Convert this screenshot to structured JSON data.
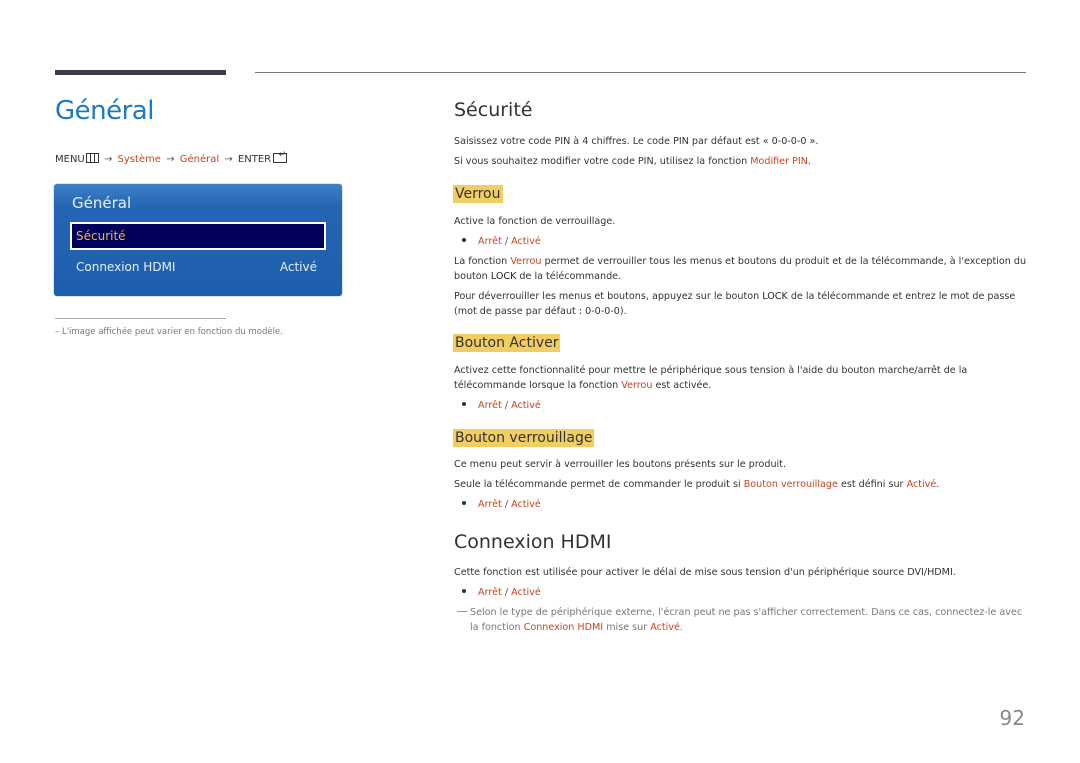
{
  "header": {
    "page_title": "Général",
    "menu_path": {
      "menu": "MENU",
      "menu_icon": "menu-grid-icon",
      "arrow": "→",
      "step1": "Système",
      "step2": "Général",
      "enter": "ENTER",
      "enter_icon": "enter-icon"
    }
  },
  "osd_menu": {
    "title": "Général",
    "items": [
      {
        "label": "Sécurité",
        "value": "",
        "selected": true
      },
      {
        "label": "Connexion HDMI",
        "value": "Activé",
        "selected": false
      }
    ]
  },
  "left_note": "–  L'image affichée peut varier en fonction du modèle.",
  "sections": {
    "securite": {
      "title": "Sécurité",
      "p1": "Saisissez votre code PIN à 4 chiffres. Le code PIN par défaut est « 0-0-0-0 ».",
      "p2_pre": "Si vous souhaitez modifier votre code PIN, utilisez la fonction ",
      "p2_link": "Modifier PIN",
      "p2_post": "."
    },
    "verrou": {
      "title": "Verrou",
      "p1": "Active la fonction de verrouillage.",
      "options": {
        "off": "Arrêt",
        "sep": "/",
        "on": "Activé"
      },
      "p2_pre": "La fonction ",
      "p2_link": "Verrou",
      "p2_mid": " permet de verrouiller tous les menus et boutons du produit et de la télécommande, à l'exception du bouton ",
      "p2_bold": "LOCK",
      "p2_post": " de la télécommande.",
      "p3_pre": "Pour déverrouiller les menus et boutons, appuyez sur le bouton ",
      "p3_bold": "LOCK",
      "p3_post": " de la télécommande et entrez le mot de passe (mot de passe par défaut : 0-0-0-0)."
    },
    "bouton_activer": {
      "title": "Bouton Activer",
      "p1_pre": "Activez cette fonctionnalité pour mettre le périphérique sous tension à l'aide du bouton marche/arrêt de la télécommande lorsque la fonction ",
      "p1_link": "Verrou",
      "p1_post": " est activée.",
      "options": {
        "off": "Arrêt",
        "sep": "/",
        "on": "Activé"
      }
    },
    "bouton_verrouillage": {
      "title": "Bouton verrouillage",
      "p1": "Ce menu peut servir à verrouiller les boutons présents sur le produit.",
      "p2_pre": "Seule la télécommande permet de commander le produit si ",
      "p2_link": "Bouton verrouillage",
      "p2_mid": " est défini sur ",
      "p2_link2": "Activé",
      "p2_post": ".",
      "options": {
        "off": "Arrêt",
        "sep": "/",
        "on": "Activé"
      }
    },
    "connexion_hdmi": {
      "title": "Connexion HDMI",
      "p1": "Cette fonction est utilisée pour activer le délai de mise sous tension d'un périphérique source DVI/HDMI.",
      "options": {
        "off": "Arrêt",
        "sep": "/",
        "on": "Activé"
      },
      "note_pre": "Selon le type de périphérique externe, l'écran peut ne pas s'afficher correctement. Dans ce cas, connectez-le avec la fonction ",
      "note_link": "Connexion HDMI",
      "note_mid": " mise sur ",
      "note_link2": "Activé",
      "note_post": "."
    }
  },
  "page_number": "92",
  "colors": {
    "title_blue": "#1a7ac4",
    "link_red": "#c6451f",
    "heading_highlight": "#f2ce62",
    "osd_blue": "#2466b4",
    "osd_selected_bg": "#00005a",
    "osd_selected_text": "#f0b640"
  }
}
